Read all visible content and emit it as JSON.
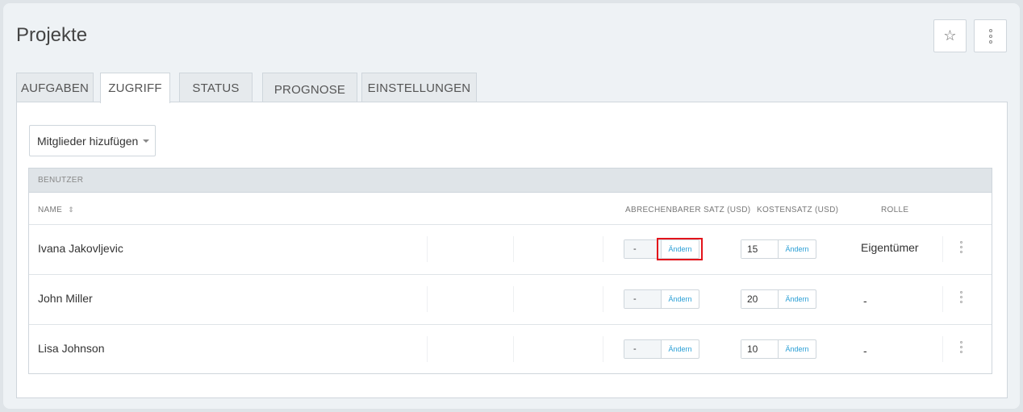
{
  "page": {
    "title": "Projekte"
  },
  "header": {
    "star_icon": "star-icon",
    "more_icon": "more-vertical-icon"
  },
  "tabs": [
    {
      "label": "AUFGABEN",
      "active": false
    },
    {
      "label": "ZUGRIFF",
      "active": true
    },
    {
      "label": "STATUS",
      "active": false
    },
    {
      "label": "PROGNOSE",
      "active": false
    },
    {
      "label": "EINSTELLUNGEN",
      "active": false
    }
  ],
  "toolbar": {
    "add_members_label": "Mitglieder hizufügen"
  },
  "table": {
    "group_label": "BENUTZER",
    "columns": {
      "name": "NAME",
      "billable_rate": "ABRECHENBARER SATZ (USD)",
      "cost_rate": "KOSTENSATZ (USD)",
      "role": "ROLLE"
    },
    "change_label": "Ändern",
    "rows": [
      {
        "name": "Ivana Jakovljevic",
        "billable": "-",
        "cost": "15",
        "role": "Eigentümer"
      },
      {
        "name": "John Miller",
        "billable": "-",
        "cost": "20",
        "role": "-"
      },
      {
        "name": "Lisa Johnson",
        "billable": "-",
        "cost": "10",
        "role": "-"
      }
    ]
  },
  "colors": {
    "accent": "#2a9fd6",
    "highlight": "#e3141b"
  }
}
